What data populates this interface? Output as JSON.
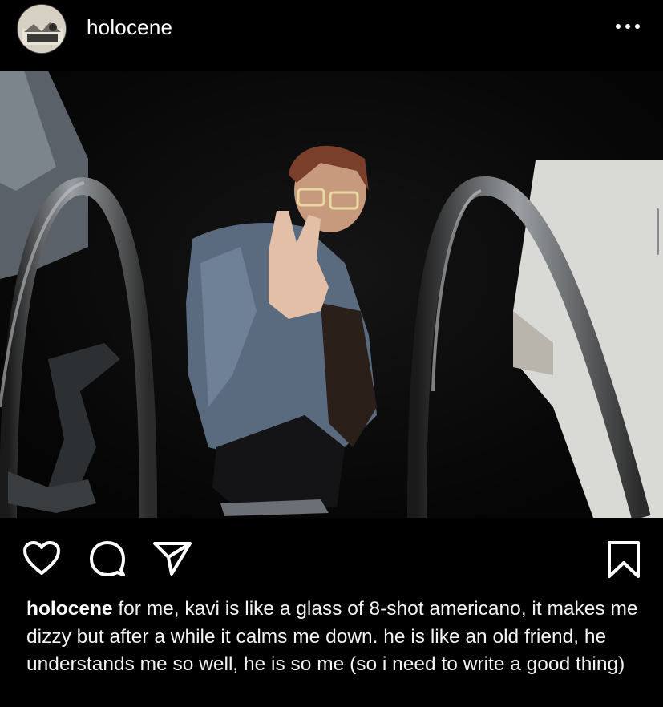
{
  "post": {
    "username": "holocene",
    "caption": "for me, kavi is like a glass of 8-shot americano, it makes me dizzy but after a while it calms me down. he is like an old friend, he understands me so well, he is so me (so i need to write a good thing)"
  },
  "icons": {
    "more": "more-options-icon",
    "like": "heart-icon",
    "comment": "comment-icon",
    "share": "share-icon",
    "save": "bookmark-icon"
  },
  "colors": {
    "background": "#000000",
    "text": "#ffffff"
  }
}
